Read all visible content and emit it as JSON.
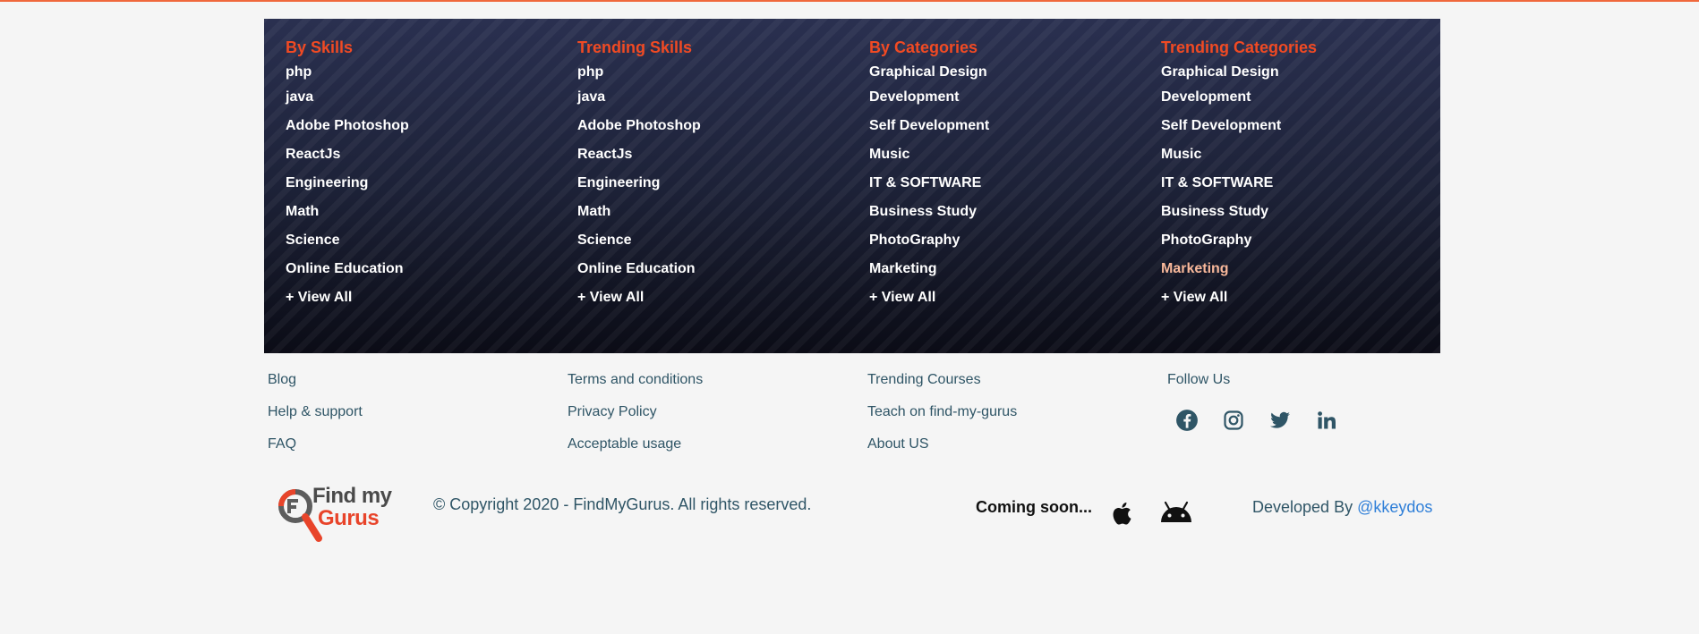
{
  "columns": [
    {
      "title": "By Skills",
      "items": [
        "php",
        "java",
        "Adobe Photoshop",
        "ReactJs",
        "Engineering",
        "Math",
        "Science",
        "Online Education",
        "+ View All"
      ]
    },
    {
      "title": "Trending Skills",
      "items": [
        "php",
        "java",
        "Adobe Photoshop",
        "ReactJs",
        "Engineering",
        "Math",
        "Science",
        "Online Education",
        "+ View All"
      ]
    },
    {
      "title": "By Categories",
      "items": [
        "Graphical Design",
        "Development",
        "Self Development",
        "Music",
        "IT & SOFTWARE",
        "Business Study",
        "PhotoGraphy",
        "Marketing",
        "+ View All"
      ]
    },
    {
      "title": "Trending Categories",
      "items": [
        "Graphical Design",
        "Development",
        "Self Development",
        "Music",
        "IT & SOFTWARE",
        "Business Study",
        "PhotoGraphy",
        "Marketing",
        "+ View All"
      ]
    }
  ],
  "links": {
    "col1": [
      "Blog",
      "Help & support",
      "FAQ"
    ],
    "col2": [
      "Terms and conditions",
      "Privacy Policy",
      "Acceptable usage"
    ],
    "col3": [
      "Trending Courses",
      "Teach on find-my-gurus",
      "About US"
    ]
  },
  "follow": {
    "title": "Follow Us",
    "icons": [
      "facebook-icon",
      "instagram-icon",
      "twitter-icon",
      "linkedin-icon"
    ]
  },
  "logo": {
    "line1": "Find my",
    "line2": "Gurus"
  },
  "copyright": "© Copyright 2020 - FindMyGurus. All rights reserved.",
  "coming_soon": "Coming soon...",
  "developed_by": {
    "prefix": "Developed By ",
    "handle": "@kkeydos"
  },
  "colors": {
    "accent": "#f14a23",
    "link": "#2f5566",
    "handle": "#2f7fd8",
    "top_line": "#f0683c"
  }
}
